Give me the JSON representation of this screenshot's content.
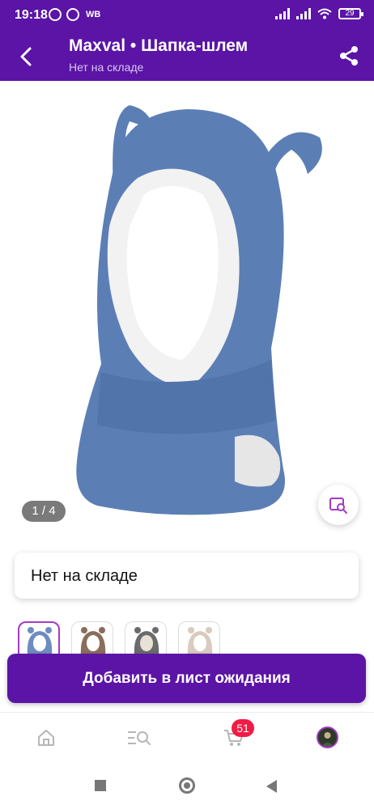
{
  "status_bar": {
    "time": "19:18",
    "carrier_label": "WB",
    "battery": "29",
    "icons": [
      "alarm-icon",
      "viber-icon",
      "signal-icon",
      "signal-icon",
      "wifi-icon",
      "battery-icon"
    ]
  },
  "header": {
    "title": "Maxval • Шапка-шлем",
    "subtitle": "Нет на складе",
    "back_icon": "chevron-left-icon",
    "share_icon": "share-icon"
  },
  "gallery": {
    "counter": "1 / 4",
    "current": 1,
    "total": 4,
    "similar_icon": "visual-search-icon",
    "product_color": "#5b7fb5"
  },
  "stock_card": {
    "text": "Нет на складе"
  },
  "thumbnails": [
    {
      "color": "#6d8cc0",
      "active": true
    },
    {
      "color": "#8a6d5a",
      "active": false
    },
    {
      "color": "#6b6b6b",
      "active": false
    },
    {
      "color": "#d9cbbd",
      "active": false
    }
  ],
  "action": {
    "label": "Добавить в лист ожидания"
  },
  "bottom_nav": {
    "items": [
      {
        "icon": "home-icon"
      },
      {
        "icon": "catalog-search-icon"
      },
      {
        "icon": "cart-icon",
        "badge": "51"
      },
      {
        "icon": "profile-avatar-icon"
      }
    ]
  },
  "colors": {
    "brand": "#5b14a6",
    "accent": "#a33bc7",
    "badge": "#f21b45"
  }
}
